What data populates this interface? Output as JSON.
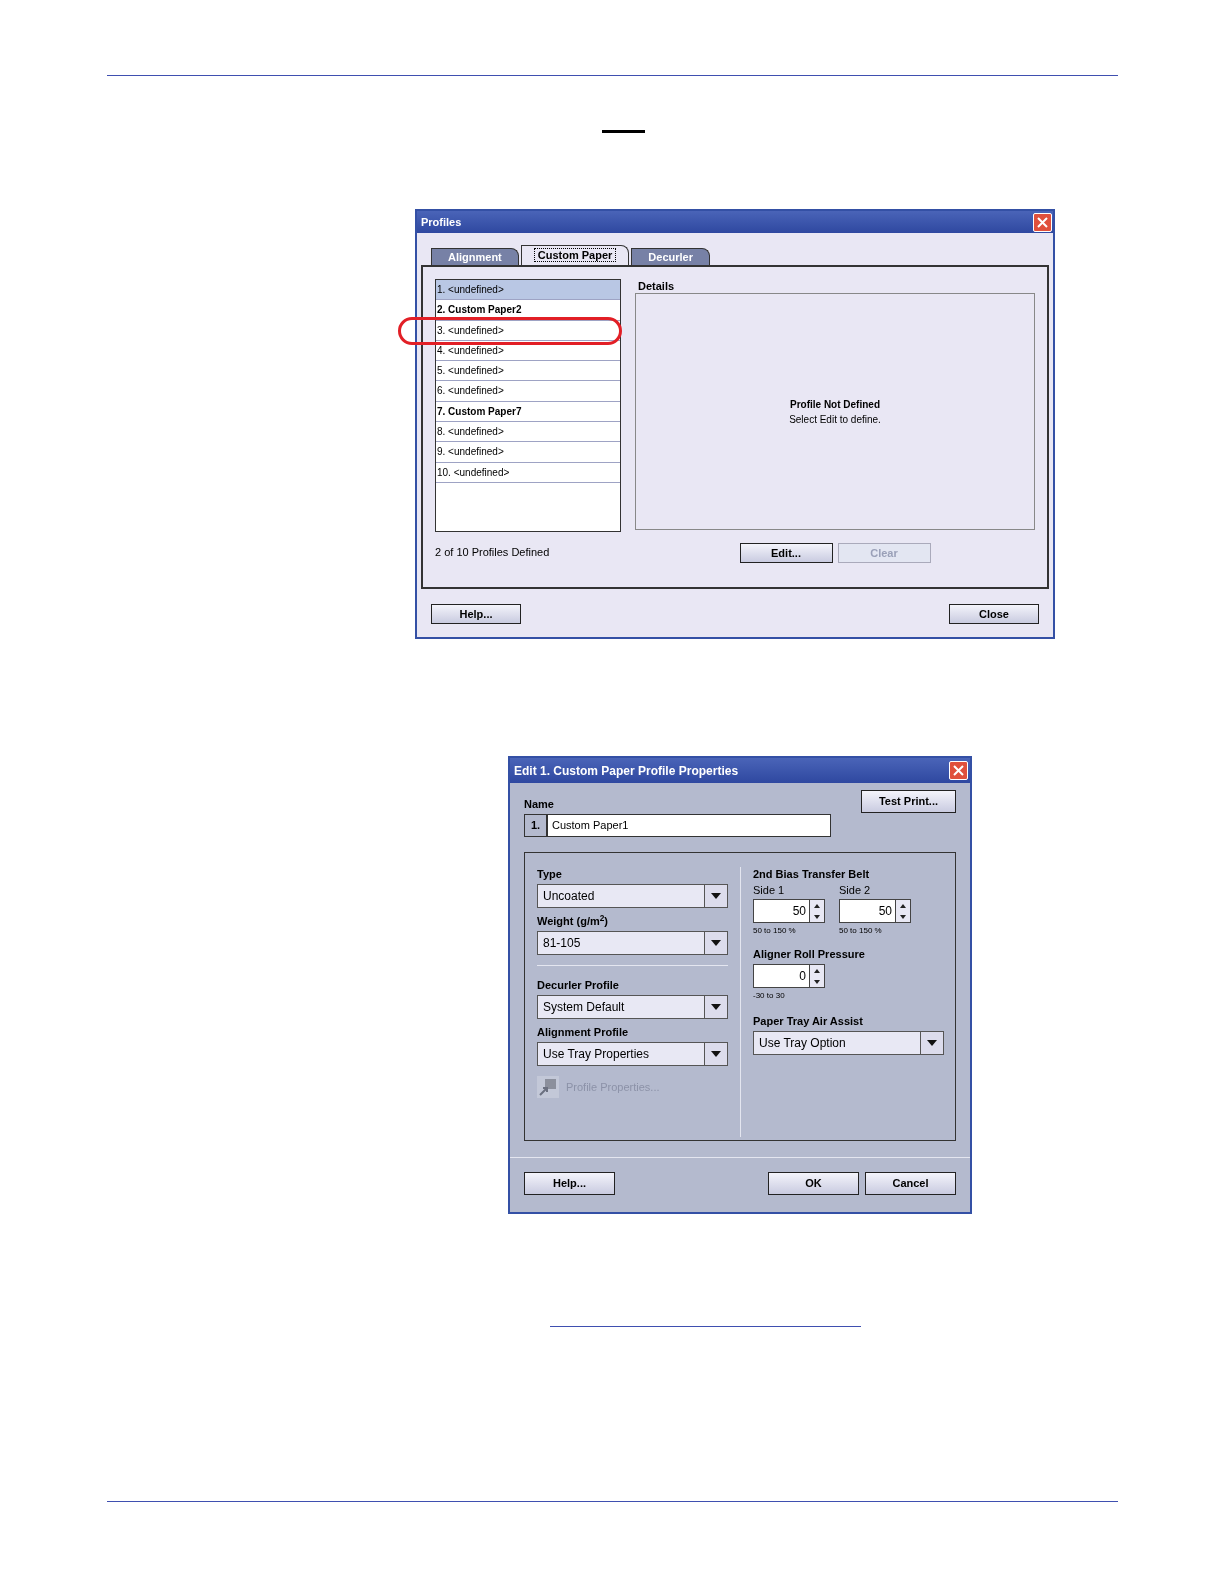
{
  "profiles_dialog": {
    "title": "Profiles",
    "tabs": [
      {
        "label": "Alignment",
        "selected": false
      },
      {
        "label": "Custom Paper",
        "selected": true
      },
      {
        "label": "Decurler",
        "selected": false
      }
    ],
    "profile_list": [
      {
        "label": "1. <undefined>",
        "selected": true,
        "defined": false,
        "circled": false
      },
      {
        "label": "2. Custom Paper2",
        "selected": false,
        "defined": true,
        "circled": false
      },
      {
        "label": "3. <undefined>",
        "selected": false,
        "defined": false,
        "circled": true
      },
      {
        "label": "4. <undefined>",
        "selected": false,
        "defined": false,
        "circled": false
      },
      {
        "label": "5. <undefined>",
        "selected": false,
        "defined": false,
        "circled": false
      },
      {
        "label": "6. <undefined>",
        "selected": false,
        "defined": false,
        "circled": false
      },
      {
        "label": "7. Custom Paper7",
        "selected": false,
        "defined": true,
        "circled": false
      },
      {
        "label": "8. <undefined>",
        "selected": false,
        "defined": false,
        "circled": false
      },
      {
        "label": "9. <undefined>",
        "selected": false,
        "defined": false,
        "circled": false
      },
      {
        "label": "10. <undefined>",
        "selected": false,
        "defined": false,
        "circled": false
      }
    ],
    "count_text": "2 of 10 Profiles Defined",
    "details_title": "Details",
    "details_message": "Profile Not Defined",
    "details_hint": "Select Edit to define.",
    "buttons": [
      {
        "label": "Edit...",
        "disabled": false
      },
      {
        "label": "Clear",
        "disabled": true
      }
    ],
    "footer_buttons": [
      "Help...",
      "Close"
    ]
  },
  "edit_dialog": {
    "title": "Edit 1. Custom Paper Profile Properties",
    "name_label": "Name",
    "name_index": "1.",
    "name_value": "Custom Paper1",
    "test_print": "Test Print...",
    "left_fields_top": [
      {
        "label": "Type",
        "value": "Uncoated"
      },
      {
        "label": "Weight (g/m$^{2}$)",
        "value": "81-105"
      }
    ],
    "left_fields_bottom": [
      {
        "label": "Decurler Profile",
        "value": "System Default"
      },
      {
        "label": "Alignment Profile",
        "value": "Use Tray Properties"
      }
    ],
    "profile_properties": {
      "label": "Profile Properties...",
      "disabled": true
    },
    "bias_title": "2nd Bias Transfer Belt",
    "bias_sides": [
      {
        "label": "Side 1",
        "value": "50",
        "range": "50 to 150 %"
      },
      {
        "label": "Side 2",
        "value": "50",
        "range": "50 to 150 %"
      }
    ],
    "aligner": {
      "label": "Aligner Roll Pressure",
      "value": "0",
      "range": "-30 to 30"
    },
    "air_assist": {
      "label": "Paper Tray Air Assist",
      "value": "Use Tray Option"
    },
    "footer_buttons": [
      {
        "kind": "left",
        "label": "Help..."
      },
      {
        "kind": "right",
        "label": "OK"
      },
      {
        "kind": "right",
        "label": "Cancel"
      }
    ]
  }
}
